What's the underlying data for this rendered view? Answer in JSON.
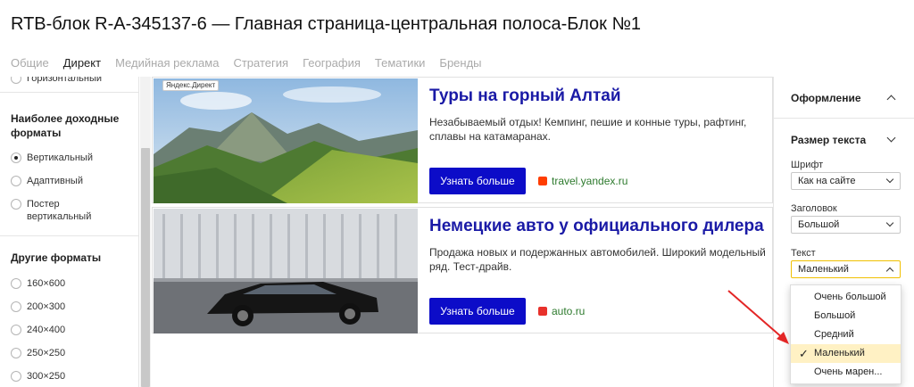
{
  "title": "RTB-блок R-A-345137-6 — Главная страница-центральная полоса-Блок №1",
  "tabs": [
    "Общие",
    "Директ",
    "Медийная реклама",
    "Стратегия",
    "География",
    "Тематики",
    "Бренды"
  ],
  "active_tab": "Директ",
  "left": {
    "partial_option": "Горизонтальный",
    "best_title": "Наиболее доходные форматы",
    "best_options": [
      "Вертикальный",
      "Адаптивный",
      "Постер вертикальный"
    ],
    "best_selected": "Вертикальный",
    "other_title": "Другие форматы",
    "other_options": [
      "160×600",
      "200×300",
      "240×400",
      "250×250",
      "300×250"
    ]
  },
  "ads": [
    {
      "badge": "Яндекс.Директ",
      "title": "Туры на горный Алтай",
      "desc": "Незабываемый отдых! Кемпинг, пешие и конные туры, рафтинг, сплавы на катамаранах.",
      "button": "Узнать больше",
      "domain": "travel.yandex.ru",
      "domain_icon_color": "#ff3d00"
    },
    {
      "title": "Немецкие авто у официального дилера",
      "desc": "Продажа новых и подержанных автомобилей. Широкий модельный ряд. Тест-драйв.",
      "button": "Узнать больше",
      "domain": "auto.ru",
      "domain_icon_color": "#e8312b"
    }
  ],
  "right": {
    "design_title": "Оформление",
    "text_size_title": "Размер текста",
    "font_label": "Шрифт",
    "font_value": "Как на сайте",
    "heading_label": "Заголовок",
    "heading_value": "Большой",
    "text_label": "Текст",
    "text_value": "Маленький"
  },
  "dropdown": {
    "options": [
      "Очень большой",
      "Большой",
      "Средний",
      "Маленький",
      "Очень марен..."
    ],
    "selected": "Маленький"
  },
  "colors": {
    "ad_title": "#1a1aa6",
    "button": "#0c0cc8",
    "domain_text": "#2d7a2d",
    "select_highlight": "#fff1c4",
    "arrow": "#e32626"
  }
}
